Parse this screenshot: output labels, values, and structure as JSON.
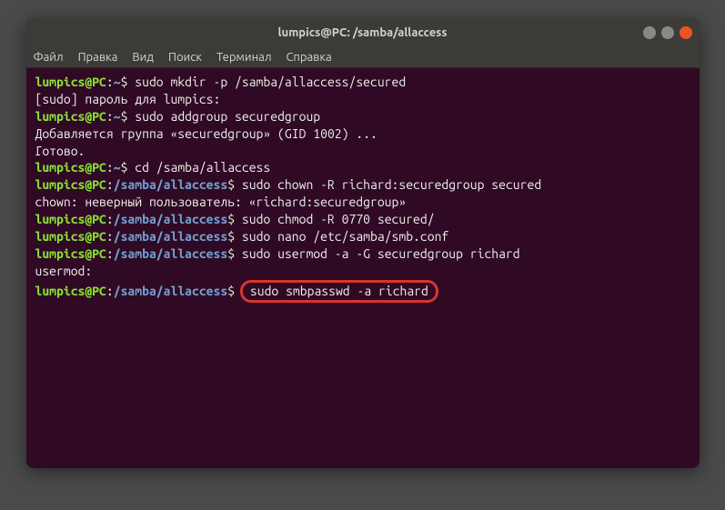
{
  "window": {
    "title": "lumpics@PC: /samba/allaccess"
  },
  "menu": {
    "file": "Файл",
    "edit": "Правка",
    "view": "Вид",
    "search": "Поиск",
    "terminal": "Терминал",
    "help": "Справка"
  },
  "lines": {
    "l1_user": "lumpics@PC",
    "l1_path": "~",
    "l1_cmd": "sudo mkdir -p /samba/allaccess/secured",
    "l2_out": "[sudo] пароль для lumpics:",
    "l3_user": "lumpics@PC",
    "l3_path": "~",
    "l3_cmd": "sudo addgroup securedgroup",
    "l4_out": "Добавляется группа «securedgroup» (GID 1002) ...",
    "l5_out": "Готово.",
    "l6_user": "lumpics@PC",
    "l6_path": "~",
    "l6_cmd": "cd /samba/allaccess",
    "l7_user": "lumpics@PC",
    "l7_path": "/samba/allaccess",
    "l7_cmd": "sudo chown -R richard:securedgroup secured",
    "l8_out": "chown: неверный пользователь: «richard:securedgroup»",
    "l9_user": "lumpics@PC",
    "l9_path": "/samba/allaccess",
    "l9_cmd": "sudo chmod -R 0770 secured/",
    "l10_user": "lumpics@PC",
    "l10_path": "/samba/allaccess",
    "l10_cmd": "sudo nano /etc/samba/smb.conf",
    "l11_user": "lumpics@PC",
    "l11_path": "/samba/allaccess",
    "l11_cmd": "sudo usermod -a -G securedgroup richard",
    "l12_out": "usermod:",
    "l13_user": "lumpics@PC",
    "l13_path": "/samba/allaccess",
    "l13_cmd": "sudo smbpasswd -a richard"
  },
  "sym": {
    "colon": ":",
    "dollar": "$ "
  }
}
